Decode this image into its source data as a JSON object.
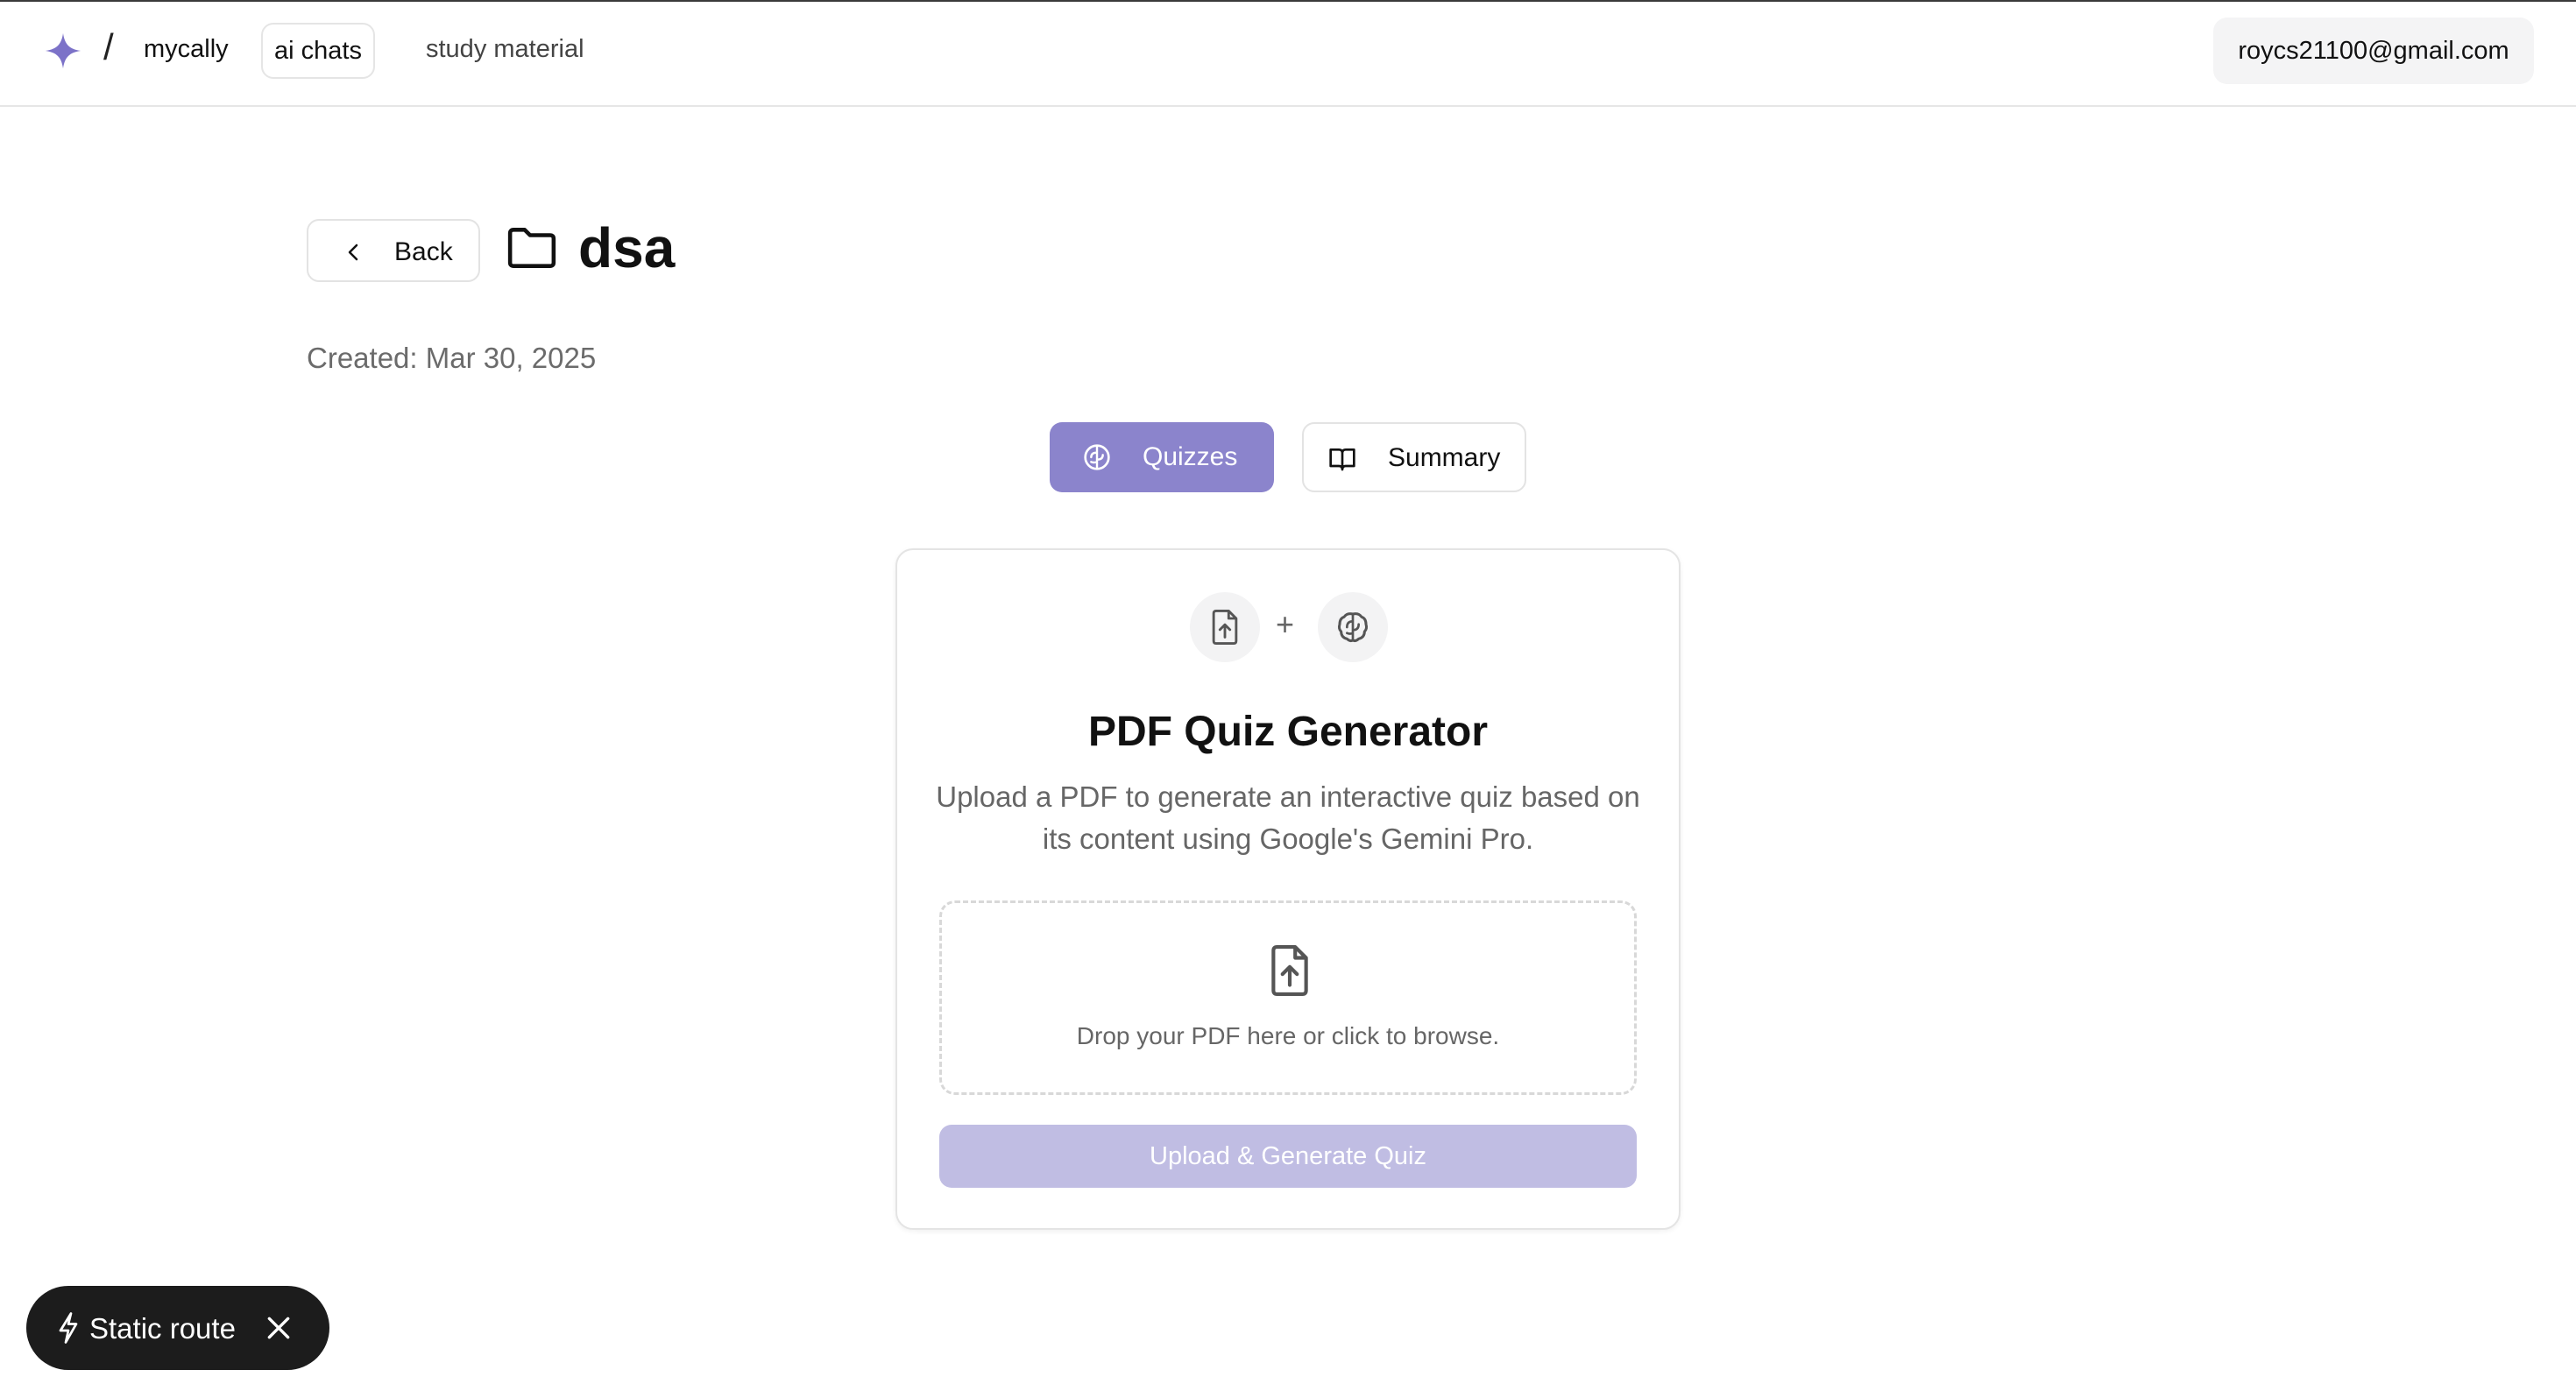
{
  "header": {
    "brand": "mycally",
    "separator": "/",
    "nav_active": "ai chats",
    "nav_link": "study material",
    "user_email": "roycs21100@gmail.com"
  },
  "page": {
    "back_label": "Back",
    "title": "dsa",
    "created": "Created: Mar 30, 2025"
  },
  "tabs": [
    {
      "label": "Quizzes",
      "icon": "brain-icon",
      "active": true
    },
    {
      "label": "Summary",
      "icon": "book-open-icon",
      "active": false
    }
  ],
  "card": {
    "plus": "+",
    "title": "PDF Quiz Generator",
    "description": "Upload a PDF to generate an interactive quiz based on its content using Google's Gemini Pro.",
    "dropzone_text": "Drop your PDF here or click to browse.",
    "button_label": "Upload & Generate Quiz"
  },
  "toast": {
    "label": "Static route",
    "icon": "bolt-icon"
  },
  "colors": {
    "accent": "#8b84cc",
    "accent_disabled": "#c0bde3",
    "logo": "#7c72c8"
  }
}
